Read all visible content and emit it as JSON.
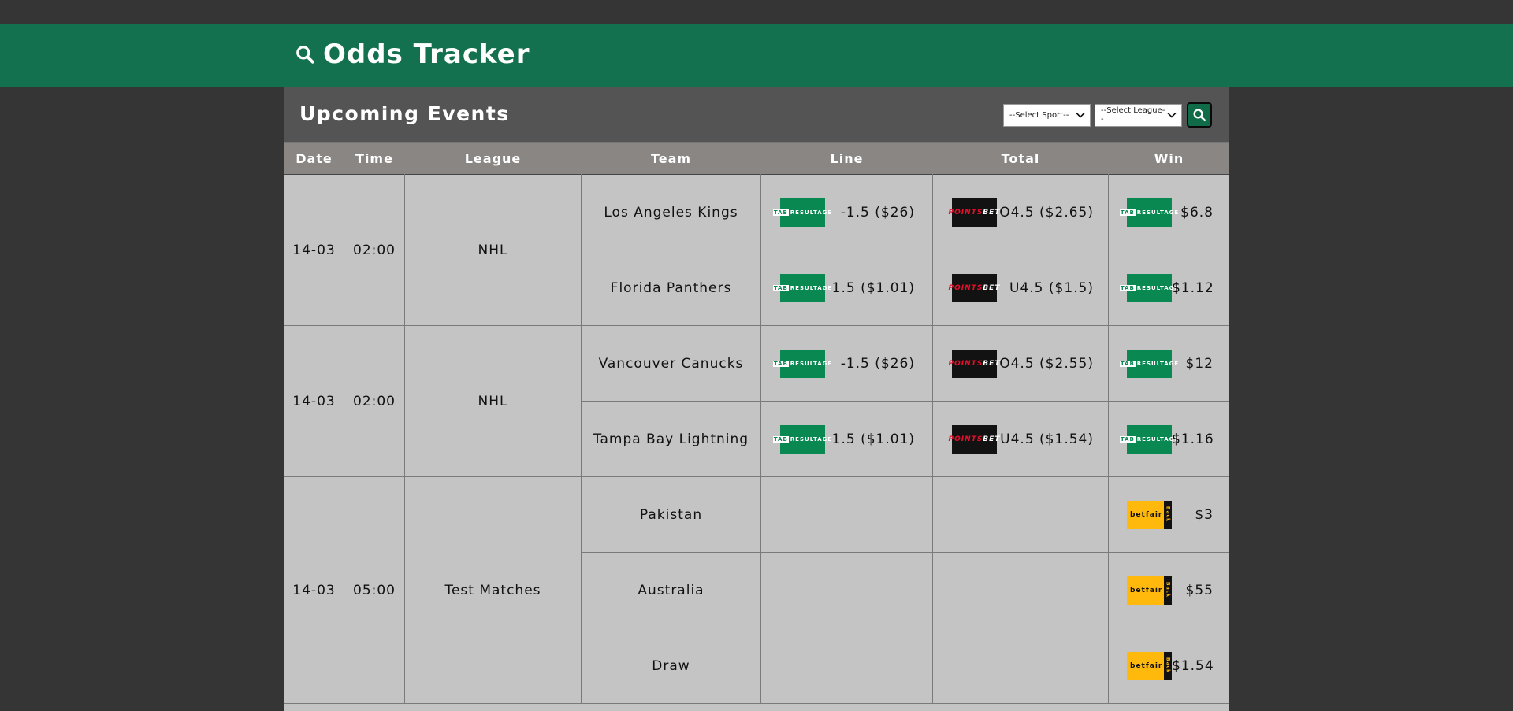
{
  "app": {
    "title": "Odds Tracker"
  },
  "panel": {
    "title": "Upcoming Events"
  },
  "filters": {
    "sport": "--Select Sport--",
    "league": "--Select League--"
  },
  "table": {
    "headers": [
      "Date",
      "Time",
      "League",
      "Team",
      "Line",
      "Total",
      "Win"
    ],
    "events": [
      {
        "date": "14-03",
        "time": "02:00",
        "league": "NHL",
        "teams": [
          {
            "team": "Los Angeles Kings",
            "line_book": "TAB",
            "line": "-1.5 ($26)",
            "total_book": "POINTSBET",
            "total": "O4.5 ($2.65)",
            "win_book": "TAB",
            "win": "$6.8"
          },
          {
            "team": "Florida Panthers",
            "line_book": "TAB",
            "line": "1.5 ($1.01)",
            "total_book": "POINTSBET",
            "total": "U4.5 ($1.5)",
            "win_book": "TAB",
            "win": "$1.12"
          }
        ]
      },
      {
        "date": "14-03",
        "time": "02:00",
        "league": "NHL",
        "teams": [
          {
            "team": "Vancouver Canucks",
            "line_book": "TAB",
            "line": "-1.5 ($26)",
            "total_book": "POINTSBET",
            "total": "O4.5 ($2.55)",
            "win_book": "TAB",
            "win": "$12"
          },
          {
            "team": "Tampa Bay Lightning",
            "line_book": "TAB",
            "line": "1.5 ($1.01)",
            "total_book": "POINTSBET",
            "total": "U4.5 ($1.54)",
            "win_book": "TAB",
            "win": "$1.16"
          }
        ]
      },
      {
        "date": "14-03",
        "time": "05:00",
        "league": "Test Matches",
        "teams": [
          {
            "team": "Pakistan",
            "line_book": "",
            "line": "",
            "total_book": "",
            "total": "",
            "win_book": "BETFAIR",
            "win": "$3"
          },
          {
            "team": "Australia",
            "line_book": "",
            "line": "",
            "total_book": "",
            "total": "",
            "win_book": "BETFAIR",
            "win": "$55"
          },
          {
            "team": "Draw",
            "line_book": "",
            "line": "",
            "total_book": "",
            "total": "",
            "win_book": "BETFAIR",
            "win": "$1.54"
          }
        ]
      }
    ]
  },
  "bookmakers": {
    "TAB": {
      "label": "TAB",
      "sub": "RESULTAGE",
      "color": "#098852"
    },
    "POINTSBET": {
      "label1": "POINTS",
      "label2": "BET",
      "color": "#121212"
    },
    "BETFAIR": {
      "label": "betfair",
      "back": "Back",
      "color": "#ffb80c"
    }
  }
}
